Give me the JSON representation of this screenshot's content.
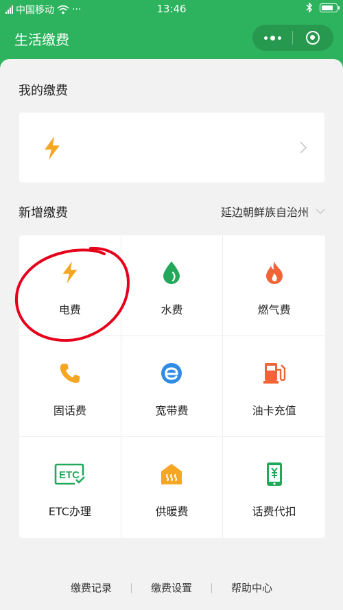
{
  "status_bar": {
    "carrier": "中国移动",
    "extra": "···",
    "time": "13:46"
  },
  "header": {
    "title": "生活缴费"
  },
  "my_payments": {
    "title": "我的缴费"
  },
  "new_payment": {
    "title": "新增缴费",
    "region": "延边朝鲜族自治州"
  },
  "services": [
    {
      "label": "电费",
      "icon": "lightning-icon",
      "color": "#f5a623"
    },
    {
      "label": "水费",
      "icon": "water-drop-icon",
      "color": "#21a85a"
    },
    {
      "label": "燃气费",
      "icon": "flame-icon",
      "color": "#f06437"
    },
    {
      "label": "固话费",
      "icon": "phone-icon",
      "color": "#f5a623"
    },
    {
      "label": "宽带费",
      "icon": "broadband-e-icon",
      "color": "#2e8be8"
    },
    {
      "label": "油卡充值",
      "icon": "fuel-pump-icon",
      "color": "#f06437"
    },
    {
      "label": "ETC办理",
      "icon": "etc-icon",
      "color": "#21a85a"
    },
    {
      "label": "供暖费",
      "icon": "heating-icon",
      "color": "#f5a623"
    },
    {
      "label": "话费代扣",
      "icon": "mobile-yuan-icon",
      "color": "#21a85a"
    }
  ],
  "footer": {
    "records": "缴费记录",
    "settings": "缴费设置",
    "help": "帮助中心"
  },
  "colors": {
    "brand_green": "#2db35d",
    "annotation_red": "#e6001a"
  }
}
